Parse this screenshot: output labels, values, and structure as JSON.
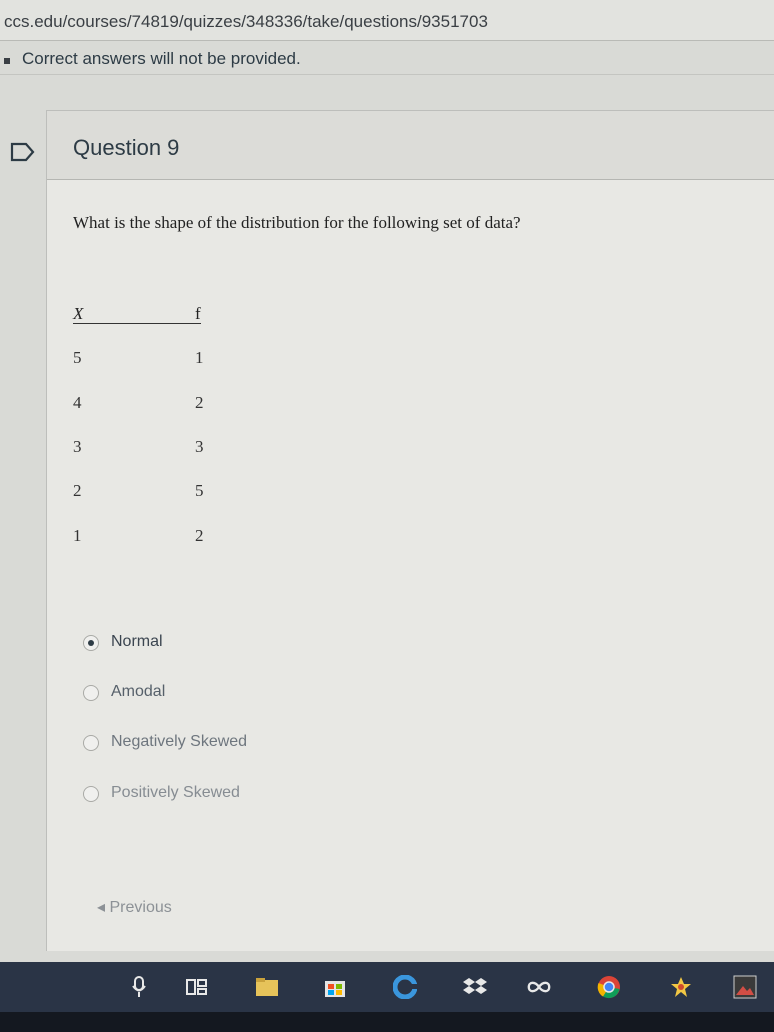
{
  "browser": {
    "url": "ccs.edu/courses/74819/quizzes/348336/take/questions/9351703"
  },
  "notice": {
    "text": "Correct answers will not be provided."
  },
  "question": {
    "title": "Question 9",
    "prompt": "What is the shape of the distribution for the following set of data?",
    "table": {
      "headers": [
        "X",
        "f"
      ],
      "rows": [
        [
          "5",
          "1"
        ],
        [
          "4",
          "2"
        ],
        [
          "3",
          "3"
        ],
        [
          "2",
          "5"
        ],
        [
          "1",
          "2"
        ]
      ]
    },
    "options": [
      {
        "label": "Normal",
        "selected": true
      },
      {
        "label": "Amodal",
        "selected": false
      },
      {
        "label": "Negatively Skewed",
        "selected": false
      },
      {
        "label": "Positively Skewed",
        "selected": false
      }
    ]
  },
  "navigation": {
    "previous_label": "Previous"
  },
  "taskbar": {
    "icons": [
      "microphone-icon",
      "task-view-icon",
      "file-explorer-icon",
      "store-icon",
      "edge-icon",
      "dropbox-icon",
      "infinity-icon",
      "chrome-icon",
      "app-icon",
      "photos-icon"
    ]
  }
}
